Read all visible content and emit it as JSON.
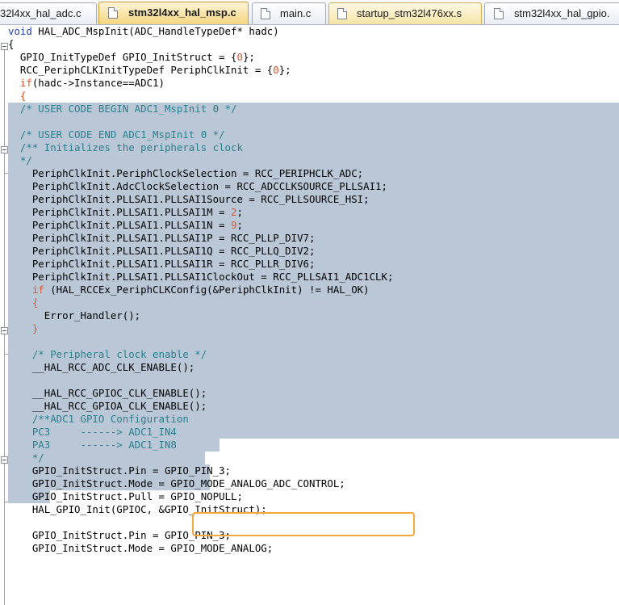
{
  "tabs": [
    {
      "label": "32l4xx_hal_adc.c",
      "active": false
    },
    {
      "label": "stm32l4xx_hal_msp.c",
      "active": true
    },
    {
      "label": "main.c",
      "active": false
    },
    {
      "label": "startup_stm32l476xx.s",
      "active": false
    },
    {
      "label": "stm32l4xx_hal_gpio.",
      "active": false
    }
  ],
  "code": {
    "l1_kw": "void",
    "l1_rest": " HAL_ADC_MspInit(ADC_HandleTypeDef* hadc)",
    "l2": "{",
    "l3_a": "  GPIO_InitTypeDef GPIO_InitStruct = {",
    "l3_n": "0",
    "l3_b": "};",
    "l4_a": "  RCC_PeriphCLKInitTypeDef PeriphClkInit = {",
    "l4_n": "0",
    "l4_b": "};",
    "l5_kw": "  if",
    "l5_rest": "(hadc->Instance==ADC1)",
    "l6": "  {",
    "l7": "  /* USER CODE BEGIN ADC1_MspInit 0 */",
    "l9": "  /* USER CODE END ADC1_MspInit 0 */",
    "l10": "  /** Initializes the peripherals clock",
    "l11": "  */",
    "l12": "    PeriphClkInit.PeriphClockSelection = RCC_PERIPHCLK_ADC;",
    "l13": "    PeriphClkInit.AdcClockSelection = RCC_ADCCLKSOURCE_PLLSAI1;",
    "l14": "    PeriphClkInit.PLLSAI1.PLLSAI1Source = RCC_PLLSOURCE_HSI;",
    "l15_a": "    PeriphClkInit.PLLSAI1.PLLSAI1M = ",
    "l15_n": "2",
    "l16_a": "    PeriphClkInit.PLLSAI1.PLLSAI1N = ",
    "l16_n": "9",
    "l17": "    PeriphClkInit.PLLSAI1.PLLSAI1P = RCC_PLLP_DIV7;",
    "l18": "    PeriphClkInit.PLLSAI1.PLLSAI1Q = RCC_PLLQ_DIV2;",
    "l19": "    PeriphClkInit.PLLSAI1.PLLSAI1R = RCC_PLLR_DIV6;",
    "l20": "    PeriphClkInit.PLLSAI1.PLLSAI1ClockOut = RCC_PLLSAI1_ADC1CLK;",
    "l21_kw": "    if",
    "l21_rest": " (HAL_RCCEx_PeriphCLKConfig(&PeriphClkInit) != HAL_OK)",
    "l22": "    {",
    "l23": "      Error_Handler();",
    "l24": "    }",
    "l26": "    /* Peripheral clock enable */",
    "l27": "    __HAL_RCC_ADC_CLK_ENABLE();",
    "l29": "    __HAL_RCC_GPIOC_CLK_ENABLE();",
    "l30": "    __HAL_RCC_GPIOA_CLK_ENABLE();",
    "l31": "    /**ADC1 GPIO Configuration",
    "l32": "    PC3     ------> ADC1_IN4",
    "l33": "    PA3     ------> ADC1_IN8",
    "l34": "    */",
    "l35": "    GPIO_InitStruct.Pin = GPIO_PIN_3;",
    "l36_a": "    GPIO_InitStruct.Mode = ",
    "l36_b": "GPIO_MODE_ANALOG_ADC_CONTROL",
    "l36_c": ";",
    "l37": "    GPIO_InitStruct.Pull = GPIO_NOPULL;",
    "l38": "    HAL_GPIO_Init(GPIOC, &GPIO_InitStruct);",
    "l40": "    GPIO_InitStruct.Pin = GPIO_PIN_3;",
    "l41": "    GPIO_InitStruct.Mode = GPIO_MODE_ANALOG;",
    "semicolon": ";"
  },
  "colors": {
    "keyword": "#1f3fbf",
    "control_keyword": "#e0562a",
    "number": "#e0562a",
    "comment": "#2a7f8f",
    "selection": "#b9c7d6",
    "highlight_box": "#f3a93b"
  }
}
